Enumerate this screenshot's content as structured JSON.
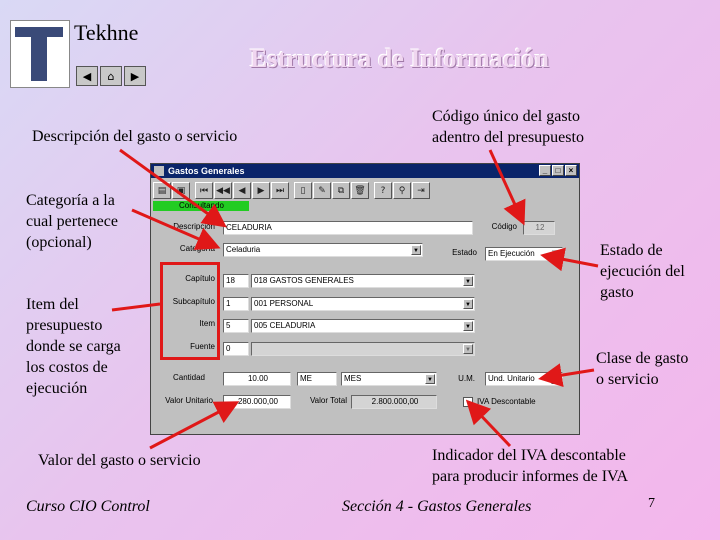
{
  "header": {
    "brand": "Tekhne",
    "title": "Estructura de Información",
    "nav_icons": [
      "back-icon",
      "home-icon",
      "forward-icon"
    ]
  },
  "callouts": {
    "descripcion": "Descripción del gasto o servicio",
    "codigo_line1": "Código único del gasto",
    "codigo_line2": "adentro del presupuesto",
    "categoria_line1": "Categoría a la",
    "categoria_line2": "cual pertenece",
    "categoria_line3": "(opcional)",
    "estado_line1": "Estado de",
    "estado_line2": "ejecución del",
    "estado_line3": "gasto",
    "item_line1": "Item del",
    "item_line2": "presupuesto",
    "item_line3": "donde se carga",
    "item_line4": "los costos de",
    "item_line5": "ejecución",
    "clase_line1": "Clase de gasto",
    "clase_line2": "o servicio",
    "valor": "Valor del gasto o servicio",
    "iva_line1": "Indicador del IVA descontable",
    "iva_line2": "para producir informes de IVA"
  },
  "window": {
    "title": "Gastos Generales",
    "status": "Consultando",
    "labels": {
      "descripcion": "Descripción",
      "codigo": "Código",
      "categoria": "Categoría",
      "estado": "Estado",
      "capitulo": "Capítulo",
      "subcapitulo": "Subcapítulo",
      "item": "Item",
      "fuente": "Fuente",
      "cantidad": "Cantidad",
      "um": "U.M.",
      "valor_unitario": "Valor Unitario",
      "valor_total": "Valor Total",
      "iva": "IVA Descontable"
    },
    "values": {
      "descripcion": "CELADURIA",
      "codigo": "12",
      "categoria": "Celaduria",
      "estado": "En Ejecución",
      "capitulo_num": "18",
      "capitulo": "018 GASTOS GENERALES",
      "subcapitulo_num": "1",
      "subcapitulo": "001 PERSONAL",
      "item_num": "5",
      "item": "005 CELADURIA",
      "fuente_num": "0",
      "cantidad": "10.00",
      "unidad": "ME",
      "unidad_desc": "MES",
      "um": "Und. Unitario",
      "valor_unitario": "280.000,00",
      "valor_total": "2.800.000,00"
    }
  },
  "footer": {
    "left": "Curso CIO Control",
    "center": "Sección 4 - Gastos Generales",
    "page": "7"
  }
}
